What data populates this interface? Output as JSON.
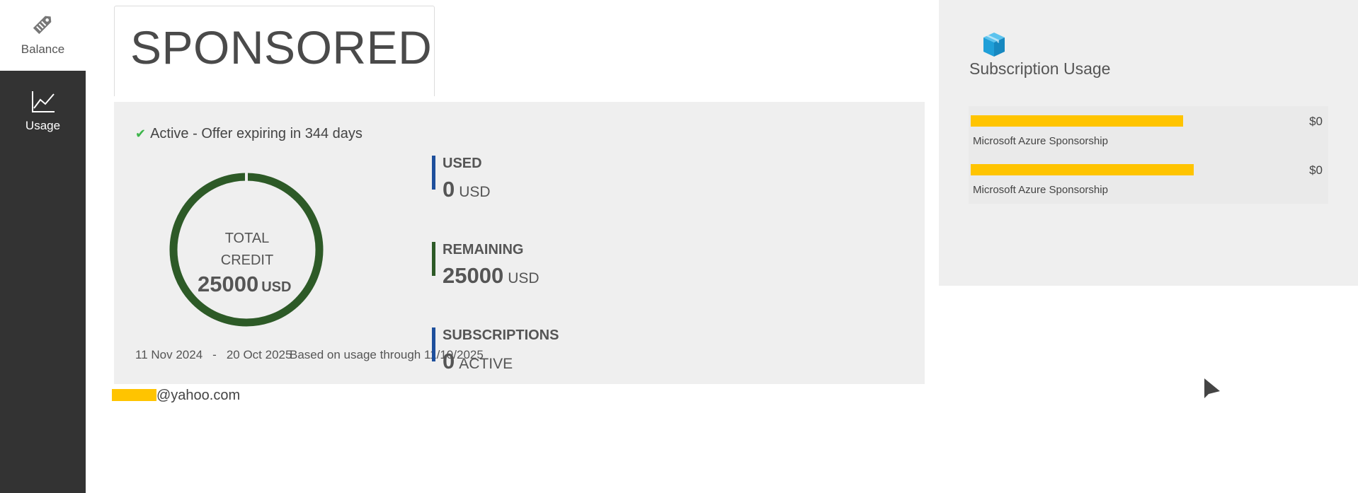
{
  "sidebar": {
    "items": [
      {
        "label": "Balance",
        "icon": "tag-icon",
        "active": true
      },
      {
        "label": "Usage",
        "icon": "line-chart-icon",
        "active": false
      }
    ]
  },
  "tab": {
    "title": "SPONSORED"
  },
  "offer": {
    "status": "Active - Offer expiring in 344 days",
    "total_label_1": "TOTAL",
    "total_label_2": "CREDIT",
    "total_value": "25000",
    "total_unit": "USD",
    "remaining_fraction": 1.0,
    "start_date": "11 Nov 2024",
    "range_separator": "-",
    "end_date": "20 Oct 2025",
    "usage_note": "Based on usage through 11/10/2025"
  },
  "metrics": {
    "used": {
      "label": "USED",
      "value": "0",
      "unit": "USD",
      "color": "#1e4f9c"
    },
    "remaining": {
      "label": "REMAINING",
      "value": "25000",
      "unit": "USD",
      "color": "#2d5a27"
    },
    "subscriptions": {
      "label": "SUBSCRIPTIONS",
      "value": "0",
      "unit": "ACTIVE",
      "color": "#1e4f9c"
    }
  },
  "account": {
    "email_suffix": "@yahoo.com"
  },
  "subscription_usage": {
    "title": "Subscription Usage",
    "items": [
      {
        "name": "Microsoft Azure Sponsorship",
        "amount": "$0",
        "fill": 0.59
      },
      {
        "name": "Microsoft Azure Sponsorship",
        "amount": "$0",
        "fill": 0.62
      }
    ]
  },
  "colors": {
    "sidebar_bg": "#333333",
    "donut": "#2d5a27",
    "usage_bar": "#ffc400",
    "check": "#3cb54a",
    "box_icon": "#29a8e0"
  }
}
